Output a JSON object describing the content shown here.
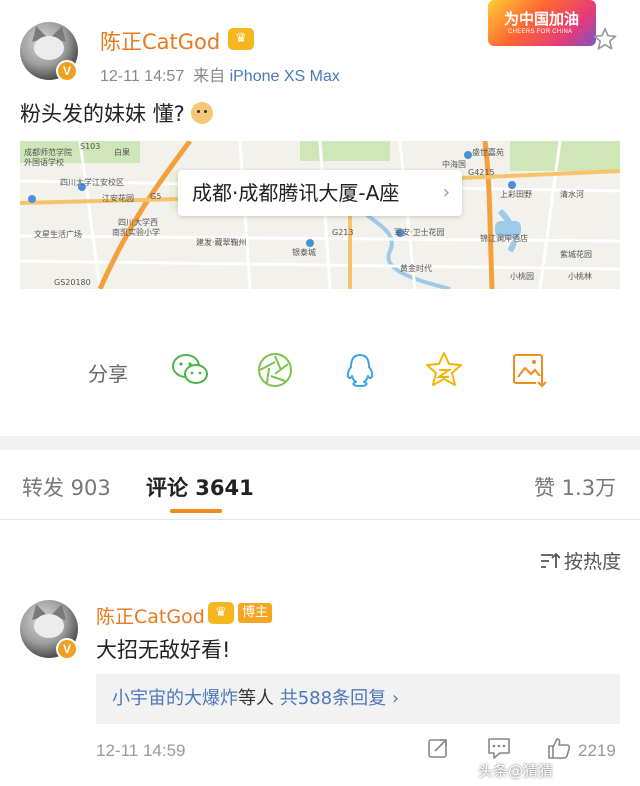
{
  "post": {
    "username": "陈正CatGod",
    "timestamp": "12-11 14:57",
    "source_prefix": "来自",
    "source_device": "iPhone XS Max",
    "text": "粉头发的妹妹 懂?",
    "campaign_badge": {
      "title": "为中国加油",
      "subtitle": "CHEERS FOR CHINA"
    }
  },
  "map": {
    "location_label": "成都·成都腾讯大厦-A座",
    "place_names": [
      "成都师范学院",
      "外国语学校",
      "S103",
      "白果",
      "盛世嘉苑",
      "G4215",
      "中海国",
      "四川大学江安校区",
      "江安花园",
      "G5",
      "上彩田野",
      "清水河",
      "文星生活广场",
      "四川大学西",
      "南凯实验小学",
      "G213",
      "军安·卫士花园",
      "建发·藏翠鞠州",
      "银泰城",
      "锦江澜岸酒店",
      "紫城花园",
      "小桃园",
      "黄金时代",
      "GS20180",
      "小桃林"
    ]
  },
  "share": {
    "label": "分享",
    "icons": [
      "wechat-icon",
      "moments-icon",
      "qq-icon",
      "qzone-icon",
      "save-image-icon"
    ]
  },
  "tabs": {
    "repost_label": "转发 903",
    "comment_label": "评论 3641",
    "like_label": "赞 1.3万"
  },
  "sort": {
    "label": "按热度"
  },
  "comment": {
    "username": "陈正CatGod",
    "author_badge": "博主",
    "text": "大招无敌好看!",
    "replies_who": "小宇宙的大爆炸",
    "replies_mid": "等人",
    "replies_total": "共588条回复",
    "timestamp": "12-11 14:59",
    "likes": "2219"
  },
  "watermark": "头条@猜猜"
}
